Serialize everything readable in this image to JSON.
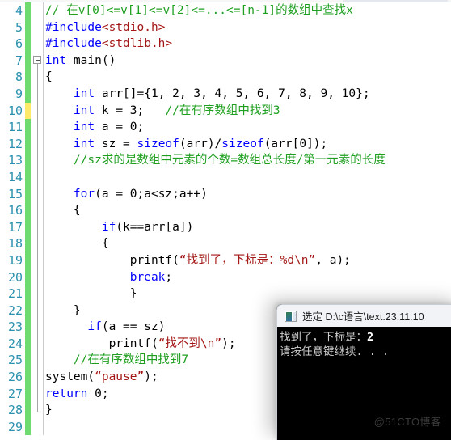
{
  "window": {
    "app": "visual-studio-code-editor"
  },
  "editor": {
    "first_visible_line": 4,
    "colors": {
      "line_number": "#2b91af",
      "change_saved": "#6fdb6f",
      "change_unsaved": "#ffe96b",
      "keyword": "#0000ff",
      "comment": "#1f9f20",
      "string": "#a31515",
      "plain": "#000000",
      "background": "#ffffff"
    },
    "lines": [
      {
        "number": "4",
        "marker": "green",
        "fold": "none",
        "tokens": [
          {
            "t": "cm",
            "s": "// 在v[0]<=v[1]<=v[2]<=...<=[n-1]的数组中查找x"
          }
        ]
      },
      {
        "number": "5",
        "marker": "green",
        "fold": "none",
        "tokens": [
          {
            "t": "pp",
            "s": "#include"
          },
          {
            "t": "inc",
            "s": "<stdio.h>"
          }
        ]
      },
      {
        "number": "6",
        "marker": "green",
        "fold": "none",
        "tokens": [
          {
            "t": "pp",
            "s": "#include"
          },
          {
            "t": "inc",
            "s": "<stdlib.h>"
          }
        ]
      },
      {
        "number": "7",
        "marker": "green",
        "fold": "box",
        "tokens": [
          {
            "t": "kw",
            "s": "int"
          },
          {
            "t": "pl",
            "s": " main()"
          }
        ]
      },
      {
        "number": "8",
        "marker": "green",
        "fold": "line",
        "tokens": [
          {
            "t": "pl",
            "s": "{"
          }
        ]
      },
      {
        "number": "9",
        "marker": "green",
        "fold": "line",
        "tokens": [
          {
            "t": "pl",
            "s": "    "
          },
          {
            "t": "kw",
            "s": "int"
          },
          {
            "t": "pl",
            "s": " arr[]={1, 2, 3, 4, 5, 6, 7, 8, 9, 10};"
          }
        ]
      },
      {
        "number": "10",
        "marker": "yellow",
        "fold": "line",
        "tokens": [
          {
            "t": "pl",
            "s": "    "
          },
          {
            "t": "kw",
            "s": "int"
          },
          {
            "t": "pl",
            "s": " k = 3;   "
          },
          {
            "t": "cm",
            "s": "//在有序数组中找到3"
          }
        ]
      },
      {
        "number": "11",
        "marker": "green",
        "fold": "line",
        "tokens": [
          {
            "t": "pl",
            "s": "    "
          },
          {
            "t": "kw",
            "s": "int"
          },
          {
            "t": "pl",
            "s": " a = 0;"
          }
        ]
      },
      {
        "number": "12",
        "marker": "green",
        "fold": "line",
        "tokens": [
          {
            "t": "pl",
            "s": "    "
          },
          {
            "t": "kw",
            "s": "int"
          },
          {
            "t": "pl",
            "s": " sz = "
          },
          {
            "t": "kw",
            "s": "sizeof"
          },
          {
            "t": "pl",
            "s": "(arr)/"
          },
          {
            "t": "kw",
            "s": "sizeof"
          },
          {
            "t": "pl",
            "s": "(arr[0]);"
          }
        ]
      },
      {
        "number": "13",
        "marker": "green",
        "fold": "line",
        "tokens": [
          {
            "t": "pl",
            "s": "    "
          },
          {
            "t": "cm",
            "s": "//sz求的是数组中元素的个数=数组总长度/第一元素的长度"
          }
        ]
      },
      {
        "number": "14",
        "marker": "green",
        "fold": "line",
        "tokens": []
      },
      {
        "number": "15",
        "marker": "green",
        "fold": "line",
        "tokens": [
          {
            "t": "pl",
            "s": "    "
          },
          {
            "t": "kw",
            "s": "for"
          },
          {
            "t": "pl",
            "s": "(a = 0;a<sz;a++)"
          }
        ]
      },
      {
        "number": "16",
        "marker": "green",
        "fold": "line",
        "tokens": [
          {
            "t": "pl",
            "s": "    {"
          }
        ]
      },
      {
        "number": "17",
        "marker": "green",
        "fold": "line",
        "tokens": [
          {
            "t": "pl",
            "s": "        "
          },
          {
            "t": "kw",
            "s": "if"
          },
          {
            "t": "pl",
            "s": "(k==arr[a])"
          }
        ]
      },
      {
        "number": "18",
        "marker": "green",
        "fold": "line",
        "tokens": [
          {
            "t": "pl",
            "s": "        {"
          }
        ]
      },
      {
        "number": "19",
        "marker": "green",
        "fold": "line",
        "tokens": [
          {
            "t": "pl",
            "s": "            printf("
          },
          {
            "t": "st",
            "s": "“找到了，下标是：%d\\n”"
          },
          {
            "t": "pl",
            "s": ", a);"
          }
        ]
      },
      {
        "number": "20",
        "marker": "green",
        "fold": "line",
        "tokens": [
          {
            "t": "pl",
            "s": "            "
          },
          {
            "t": "kw",
            "s": "break"
          },
          {
            "t": "pl",
            "s": ";"
          }
        ]
      },
      {
        "number": "21",
        "marker": "green",
        "fold": "line",
        "tokens": [
          {
            "t": "pl",
            "s": "            }"
          }
        ]
      },
      {
        "number": "22",
        "marker": "green",
        "fold": "line",
        "tokens": [
          {
            "t": "pl",
            "s": "    }"
          }
        ]
      },
      {
        "number": "23",
        "marker": "green",
        "fold": "line",
        "tokens": [
          {
            "t": "pl",
            "s": "      "
          },
          {
            "t": "kw",
            "s": "if"
          },
          {
            "t": "pl",
            "s": "(a == sz)"
          }
        ]
      },
      {
        "number": "24",
        "marker": "green",
        "fold": "line",
        "tokens": [
          {
            "t": "pl",
            "s": "         printf("
          },
          {
            "t": "st",
            "s": "“找不到\\n”"
          },
          {
            "t": "pl",
            "s": ");"
          }
        ]
      },
      {
        "number": "25",
        "marker": "green",
        "fold": "line",
        "tokens": [
          {
            "t": "pl",
            "s": "    "
          },
          {
            "t": "cm",
            "s": "//在有序数组中找到7"
          }
        ]
      },
      {
        "number": "26",
        "marker": "green",
        "fold": "line",
        "tokens": [
          {
            "t": "pl",
            "s": "system("
          },
          {
            "t": "st",
            "s": "“pause”"
          },
          {
            "t": "pl",
            "s": ");"
          }
        ]
      },
      {
        "number": "27",
        "marker": "green",
        "fold": "line",
        "tokens": [
          {
            "t": "kw",
            "s": "return"
          },
          {
            "t": "pl",
            "s": " 0;"
          }
        ]
      },
      {
        "number": "28",
        "marker": "green",
        "fold": "end",
        "tokens": [
          {
            "t": "pl",
            "s": "}"
          }
        ]
      },
      {
        "number": "29",
        "marker": "green",
        "fold": "none",
        "tokens": []
      }
    ]
  },
  "console": {
    "icon": "cmd-icon",
    "title": "选定 D:\\c语言\\text.23.11.10",
    "output": [
      {
        "text": "找到了，下标是：",
        "value": "2"
      },
      {
        "text": "请按任意键继续. . .",
        "value": ""
      }
    ]
  },
  "watermark": {
    "text": "@51CTO博客"
  }
}
